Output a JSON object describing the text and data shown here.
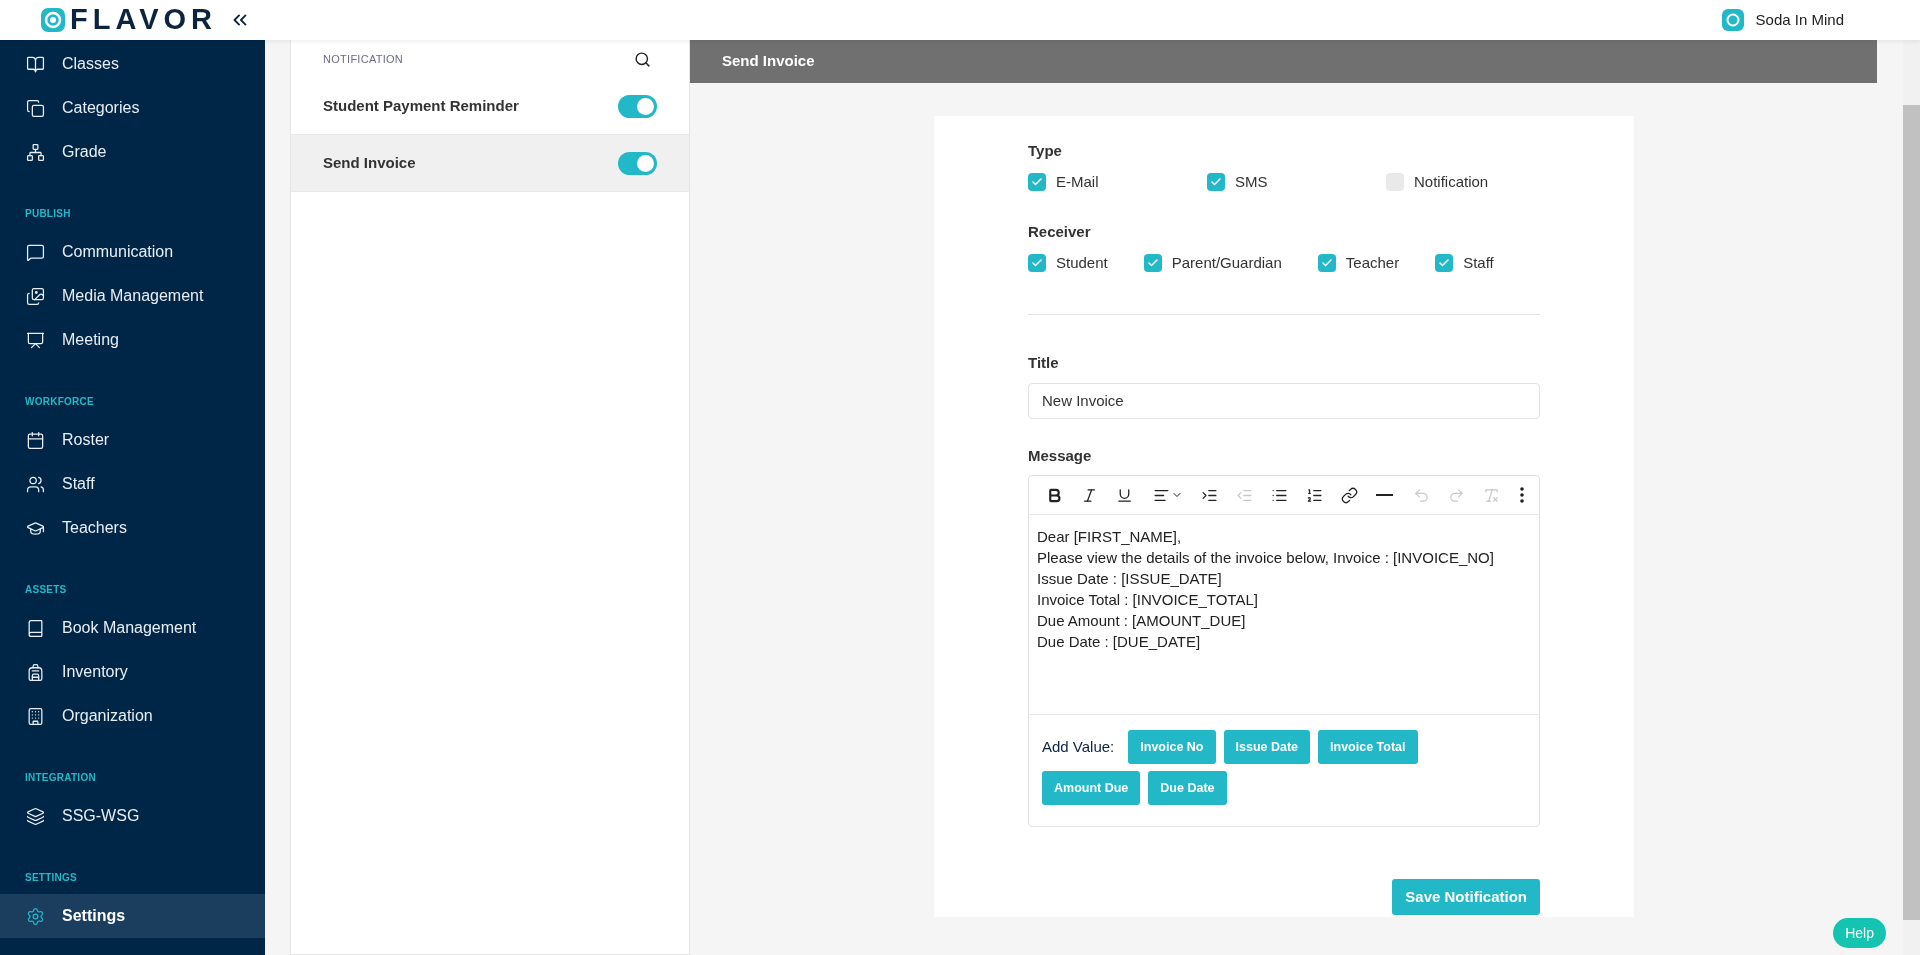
{
  "header": {
    "logo": "FLAVOR",
    "user": "Soda In Mind"
  },
  "sidebar": {
    "sections": [
      {
        "items": [
          {
            "label": "Classes",
            "selected": false
          },
          {
            "label": "Categories",
            "selected": false
          },
          {
            "label": "Grade",
            "selected": false
          }
        ]
      },
      {
        "title": "PUBLISH",
        "items": [
          {
            "label": "Communication",
            "selected": false
          },
          {
            "label": "Media Management",
            "selected": false
          },
          {
            "label": "Meeting",
            "selected": false
          }
        ]
      },
      {
        "title": "WORKFORCE",
        "items": [
          {
            "label": "Roster",
            "selected": false
          },
          {
            "label": "Staff",
            "selected": false
          },
          {
            "label": "Teachers",
            "selected": false
          }
        ]
      },
      {
        "title": "ASSETS",
        "items": [
          {
            "label": "Book Management",
            "selected": false
          },
          {
            "label": "Inventory",
            "selected": false
          },
          {
            "label": "Organization",
            "selected": false
          }
        ]
      },
      {
        "title": "INTEGRATION",
        "items": [
          {
            "label": "SSG-WSG",
            "selected": false
          }
        ]
      },
      {
        "title": "SETTINGS",
        "items": [
          {
            "label": "Settings",
            "selected": true
          }
        ]
      }
    ]
  },
  "notification_list": {
    "title": "NOTIFICATION",
    "items": [
      {
        "label": "Student Payment Reminder",
        "on": true,
        "selected": false
      },
      {
        "label": "Send Invoice",
        "on": true,
        "selected": true
      }
    ]
  },
  "detail": {
    "title": "Send Invoice",
    "type": {
      "label": "Type",
      "options": [
        {
          "label": "E-Mail",
          "checked": true
        },
        {
          "label": "SMS",
          "checked": true
        },
        {
          "label": "Notification",
          "checked": false
        }
      ]
    },
    "receiver": {
      "label": "Receiver",
      "options": [
        {
          "label": "Student",
          "checked": true
        },
        {
          "label": "Parent/Guardian",
          "checked": true
        },
        {
          "label": "Teacher",
          "checked": true
        },
        {
          "label": "Staff",
          "checked": true
        }
      ]
    },
    "title_field": {
      "label": "Title",
      "value": "New Invoice"
    },
    "message": {
      "label": "Message",
      "toolbar": [
        {
          "kind": "bold",
          "disabled": false
        },
        {
          "kind": "italic",
          "disabled": false
        },
        {
          "kind": "underline",
          "disabled": false
        },
        {
          "kind": "align",
          "disabled": false
        },
        {
          "kind": "indent",
          "disabled": false
        },
        {
          "kind": "outdent",
          "disabled": true
        },
        {
          "kind": "bullets",
          "disabled": false
        },
        {
          "kind": "numbers",
          "disabled": false
        },
        {
          "kind": "link",
          "disabled": false
        },
        {
          "kind": "rule",
          "disabled": false
        },
        {
          "kind": "undo",
          "disabled": true
        },
        {
          "kind": "redo",
          "disabled": true
        },
        {
          "kind": "clear",
          "disabled": true
        },
        {
          "kind": "more",
          "disabled": false
        }
      ],
      "lines": [
        "Dear [FIRST_NAME],",
        "Please view the details of the invoice below, Invoice : [INVOICE_NO]",
        "Issue Date : [ISSUE_DATE]",
        "Invoice Total : [INVOICE_TOTAL]",
        "Due Amount : [AMOUNT_DUE]",
        "Due Date : [DUE_DATE]"
      ],
      "add_value_label": "Add Value:",
      "add_value_buttons": [
        "Invoice No",
        "Issue Date",
        "Invoice Total",
        "Amount Due",
        "Due Date"
      ]
    },
    "save_button": "Save Notification"
  },
  "help_button": "Help"
}
